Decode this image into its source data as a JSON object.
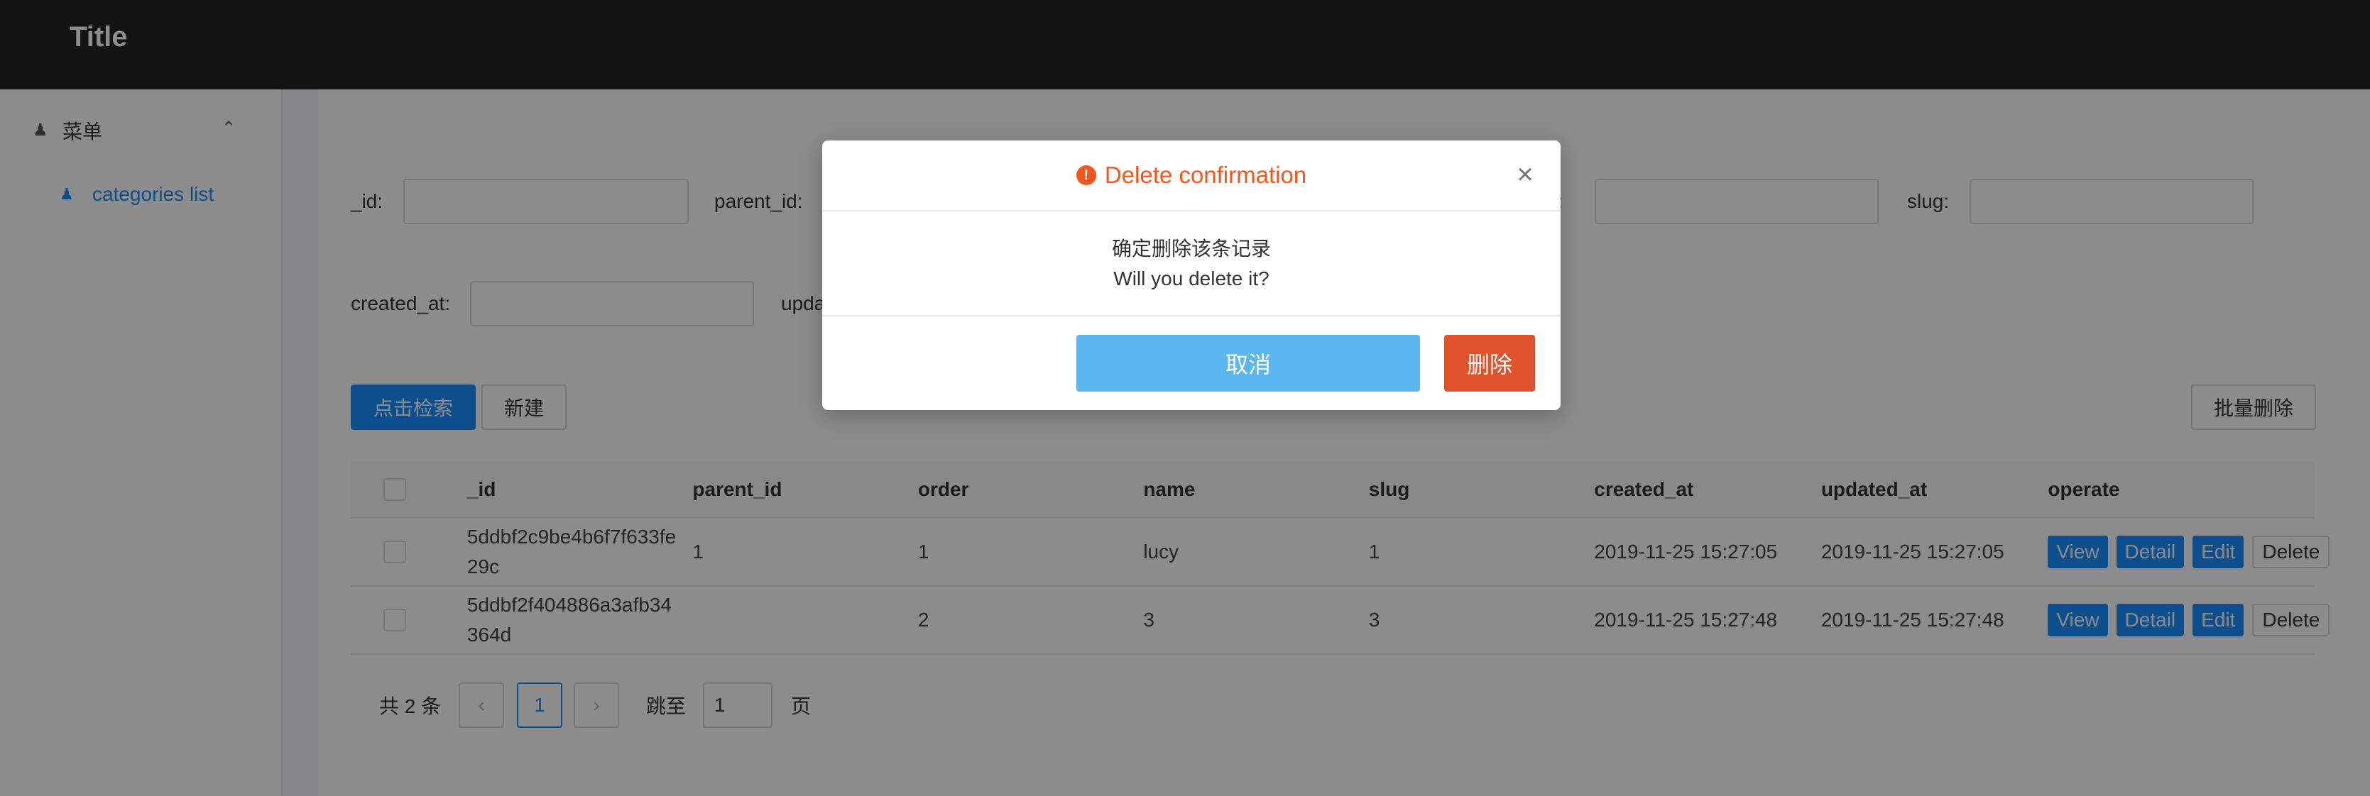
{
  "header": {
    "title": "Title"
  },
  "sidebar": {
    "menu_label": "菜单",
    "items": [
      {
        "label": "categories list"
      }
    ]
  },
  "filters": {
    "id_label": "_id:",
    "parent_id_label": "parent_id:",
    "name_label_partial": "e:",
    "slug_label": "slug:",
    "created_at_label": "created_at:",
    "updated_label_partial": "upda"
  },
  "toolbar": {
    "search_label": "点击检索",
    "new_label": "新建",
    "batch_delete_label": "批量删除"
  },
  "table": {
    "columns": [
      "_id",
      "parent_id",
      "order",
      "name",
      "slug",
      "created_at",
      "updated_at",
      "operate"
    ],
    "rows": [
      {
        "id": "5ddbf2c9be4b6f7f633fe29c",
        "parent_id": "1",
        "order": "1",
        "name": "lucy",
        "slug": "1",
        "created_at": "2019-11-25 15:27:05",
        "updated_at": "2019-11-25 15:27:05"
      },
      {
        "id": "5ddbf2f404886a3afb34364d",
        "parent_id": "",
        "order": "2",
        "name": "3",
        "slug": "3",
        "created_at": "2019-11-25 15:27:48",
        "updated_at": "2019-11-25 15:27:48"
      }
    ],
    "actions": {
      "view": "View",
      "detail": "Detail",
      "edit": "Edit",
      "delete": "Delete"
    }
  },
  "pagination": {
    "total": "共 2 条",
    "prev": "‹",
    "current_page": "1",
    "next": "›",
    "jump_label": "跳至",
    "jump_value": "1",
    "page_suffix": "页"
  },
  "modal": {
    "title": "Delete confirmation",
    "warn_glyph": "!",
    "close_glyph": "×",
    "message_cn": "确定删除该条记录",
    "message_en": "Will you delete it?",
    "cancel_label": "取消",
    "delete_label": "删除"
  },
  "colors": {
    "header_bg": "#232323",
    "accent": "#1890ff",
    "warning": "#fa541c",
    "delete_button": "#e0522a",
    "cancel_button": "#5cb6f2"
  }
}
